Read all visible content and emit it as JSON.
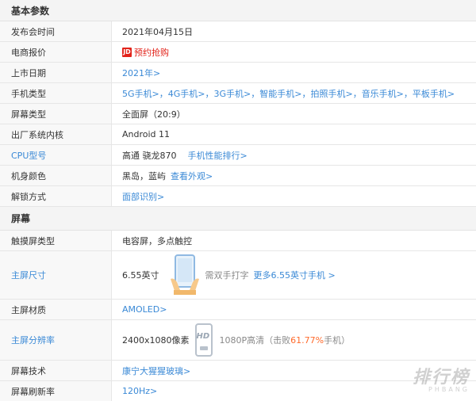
{
  "basic": {
    "title": "基本参数",
    "release": {
      "label": "发布会时间",
      "value": "2021年04月15日"
    },
    "price": {
      "label": "电商报价",
      "jd": "JD",
      "link": "预约抢购"
    },
    "listing": {
      "label": "上市日期",
      "link": "2021年>"
    },
    "phone_type": {
      "label": "手机类型",
      "links": [
        "5G手机>",
        "4G手机>",
        "3G手机>",
        "智能手机>",
        "拍照手机>",
        "音乐手机>",
        "平板手机>"
      ]
    },
    "screen_type": {
      "label": "屏幕类型",
      "value": "全面屏（20:9）"
    },
    "os": {
      "label": "出厂系统内核",
      "value": "Android 11"
    },
    "cpu": {
      "label": "CPU型号",
      "value": "高通 骁龙870",
      "link": "手机性能排行>"
    },
    "color": {
      "label": "机身颜色",
      "value": "黑岛，蓝屿",
      "link": "查看外观>"
    },
    "unlock": {
      "label": "解锁方式",
      "link": "面部识别>"
    }
  },
  "screen": {
    "title": "屏幕",
    "touch": {
      "label": "触摸屏类型",
      "value": "电容屏，多点触控"
    },
    "size": {
      "label": "主屏尺寸",
      "value": "6.55英寸",
      "note": "需双手打字",
      "link": "更多6.55英寸手机 >"
    },
    "material": {
      "label": "主屏材质",
      "link": "AMOLED>"
    },
    "resolution": {
      "label": "主屏分辨率",
      "value": "2400x1080像素",
      "badge": "HD",
      "note_prefix": "1080P高清（击败",
      "note_pct": "61.77%",
      "note_suffix": "手机）"
    },
    "tech": {
      "label": "屏幕技术",
      "link": "康宁大猩猩玻璃>"
    },
    "refresh": {
      "label": "屏幕刷新率",
      "link": "120Hz>"
    }
  },
  "watermark": {
    "big": "排行榜",
    "small": "PHBANG"
  },
  "colors": {
    "link": "#3a89d6",
    "jd": "#e2231a",
    "percent": "#ff6a2b"
  }
}
